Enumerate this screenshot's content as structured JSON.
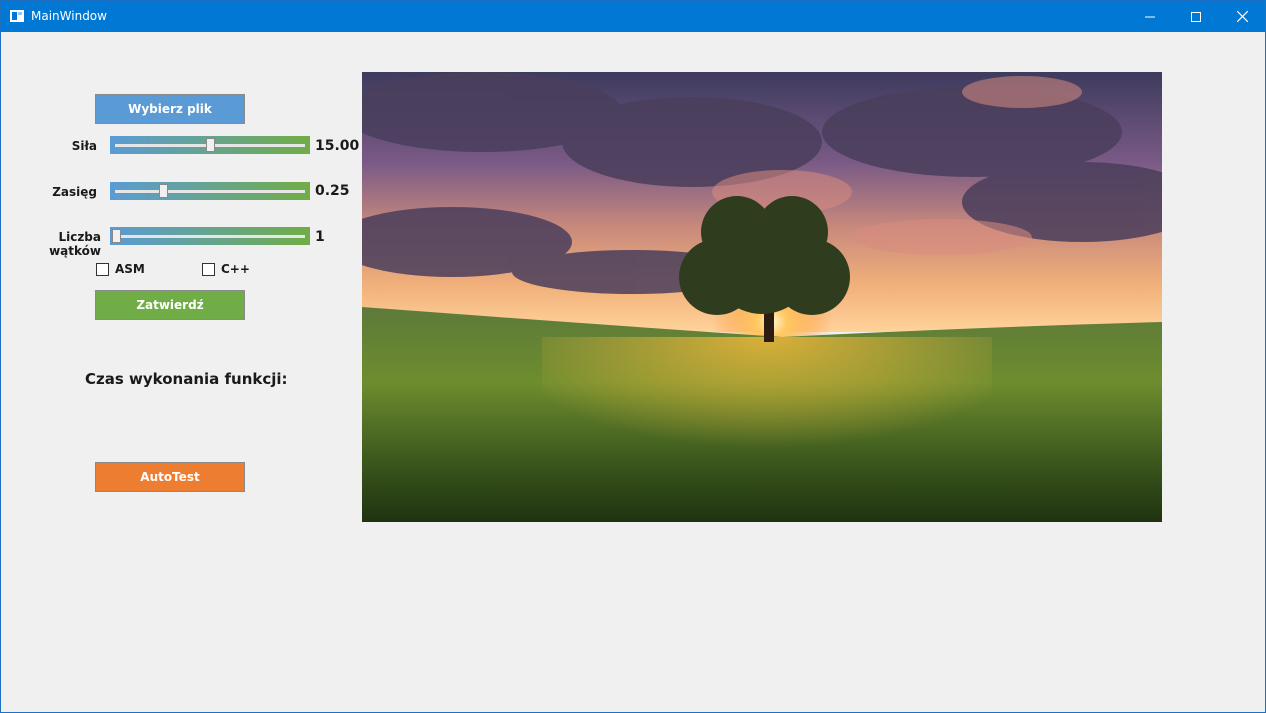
{
  "window": {
    "title": "MainWindow",
    "controls": {
      "minimize_icon": "minimize-icon",
      "maximize_icon": "maximize-icon",
      "close_icon": "close-icon"
    }
  },
  "controls": {
    "select_file_label": "Wybierz plik",
    "sliders": [
      {
        "label": "Siła",
        "value_text": "15.00",
        "position_fraction": 0.5
      },
      {
        "label": "Zasięg",
        "value_text": "0.25",
        "position_fraction": 0.25
      },
      {
        "label": "Liczba wątków",
        "value_text": "1",
        "position_fraction": 0.0
      }
    ],
    "checkboxes": [
      {
        "label": "ASM",
        "checked": false
      },
      {
        "label": "C++",
        "checked": false
      }
    ],
    "confirm_label": "Zatwierdź",
    "execution_time_label": "Czas wykonania funkcji:",
    "autotest_label": "AutoTest"
  },
  "preview": {
    "icon": "landscape-image",
    "subject": "tree-at-sunset-field"
  },
  "colors": {
    "titlebar": "#0078d4",
    "file_button": "#5b9bd5",
    "confirm_button": "#70ad47",
    "autotest_button": "#ed7d31"
  }
}
